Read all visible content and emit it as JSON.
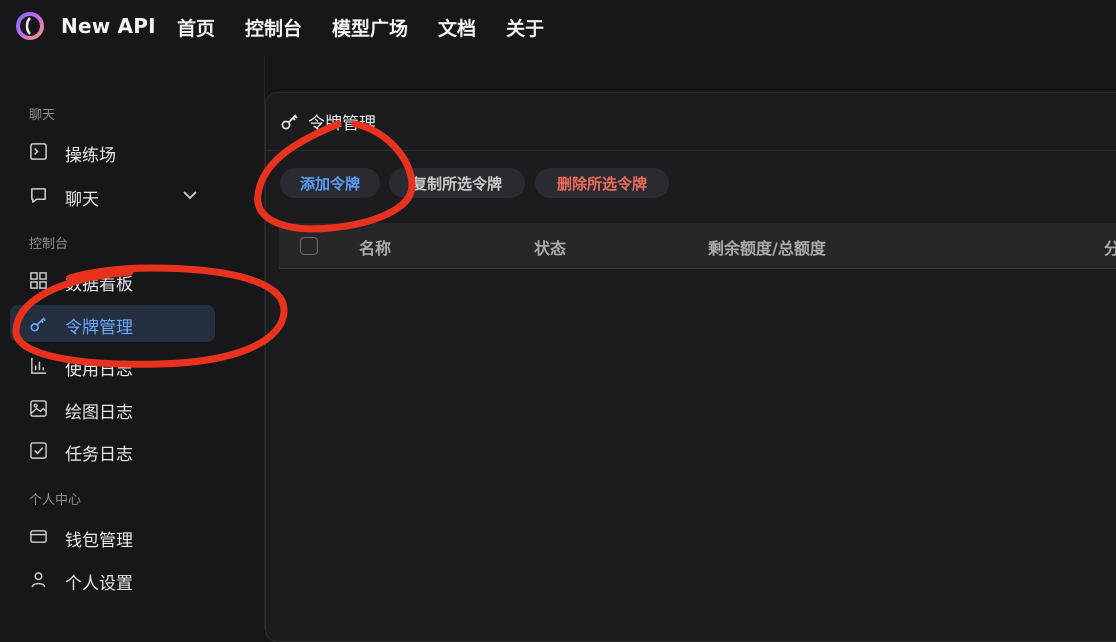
{
  "app": {
    "brand": "New API",
    "nav": [
      "首页",
      "控制台",
      "模型广场",
      "文档",
      "关于"
    ]
  },
  "sidebar": {
    "sections": [
      {
        "label": "聊天",
        "items": [
          {
            "label": "操练场",
            "icon": "terminal-icon"
          },
          {
            "label": "聊天",
            "icon": "chat-bubble-icon",
            "expandable": true
          }
        ]
      },
      {
        "label": "控制台",
        "items": [
          {
            "label": "数据看板",
            "icon": "dashboard-grid-icon"
          },
          {
            "label": "令牌管理",
            "icon": "key-icon",
            "active": true
          },
          {
            "label": "使用日志",
            "icon": "bar-chart-icon"
          },
          {
            "label": "绘图日志",
            "icon": "image-icon"
          },
          {
            "label": "任务日志",
            "icon": "checkbox-icon"
          }
        ]
      },
      {
        "label": "个人中心",
        "items": [
          {
            "label": "钱包管理",
            "icon": "wallet-icon"
          },
          {
            "label": "个人设置",
            "icon": "user-icon"
          }
        ]
      }
    ]
  },
  "main": {
    "title": "令牌管理",
    "buttons": {
      "add": "添加令牌",
      "copy": "复制所选令牌",
      "delete": "删除所选令牌"
    },
    "table": {
      "columns": [
        "名称",
        "状态",
        "剩余额度/总额度",
        "分"
      ]
    }
  },
  "colors": {
    "accent": "#5d9cf8",
    "danger": "#ef6b5c",
    "annotation": "#e8321e"
  }
}
